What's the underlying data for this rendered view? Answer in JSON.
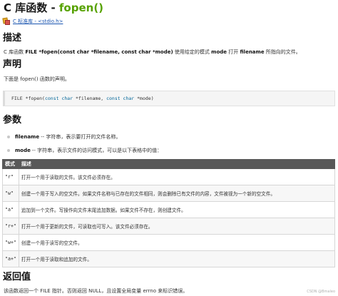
{
  "header": {
    "title_prefix": "C 库函数 - ",
    "title_fn": "fopen()",
    "breadcrumb": "C 标准库 - <stdio.h>"
  },
  "description": {
    "heading": "描述",
    "text_prefix": "C 库函数 ",
    "signature": "FILE *fopen(const char *filename, const char *mode)",
    "text_mid": " 使用给定的模式 ",
    "mode_word": "mode",
    "text_mid2": " 打开 ",
    "filename_word": "filename",
    "text_suffix": " 所指向的文件。"
  },
  "declaration": {
    "heading": "声明",
    "text": "下面是 fopen() 函数的声明。",
    "code_type": "FILE",
    "code_rest1": " *fopen(",
    "code_kw1": "const char",
    "code_rest2": " *filename, ",
    "code_kw2": "const char",
    "code_rest3": " *mode)"
  },
  "parameters": {
    "heading": "参数",
    "items": [
      {
        "name": "filename",
        "desc": "-- 字符串，表示要打开的文件名称。"
      },
      {
        "name": "mode",
        "desc": "-- 字符串，表示文件的访问模式，可以是以下表格中的值："
      }
    ]
  },
  "mode_table": {
    "headers": [
      "模式",
      "描述"
    ],
    "rows": [
      {
        "mode": "\"r\"",
        "desc": "打开一个用于读取的文件。该文件必须存在。"
      },
      {
        "mode": "\"w\"",
        "desc": "创建一个用于写入的空文件。如果文件名称与已存在的文件相同，则会删除已有文件的内容，文件被视为一个新的空文件。"
      },
      {
        "mode": "\"a\"",
        "desc": "追加到一个文件。写操作向文件末尾追加数据。如果文件不存在，则创建文件。"
      },
      {
        "mode": "\"r+\"",
        "desc": "打开一个用于更新的文件，可读取也可写入。该文件必须存在。"
      },
      {
        "mode": "\"w+\"",
        "desc": "创建一个用于读写的空文件。"
      },
      {
        "mode": "\"a+\"",
        "desc": "打开一个用于读取和追加的文件。"
      }
    ]
  },
  "return_value": {
    "heading": "返回值",
    "text": "该函数返回一个 FILE 指针。否则返回 NULL，且设置全局变量 errno 来标识错误。"
  },
  "watermark": "CSDN @Bmaleo",
  "icons": {
    "breadcrumb": "book-icon",
    "bullet": "bullet-dot-icon"
  },
  "colors": {
    "function_name": "#57a200",
    "table_header": "#585858",
    "link": "#1a55b0"
  }
}
